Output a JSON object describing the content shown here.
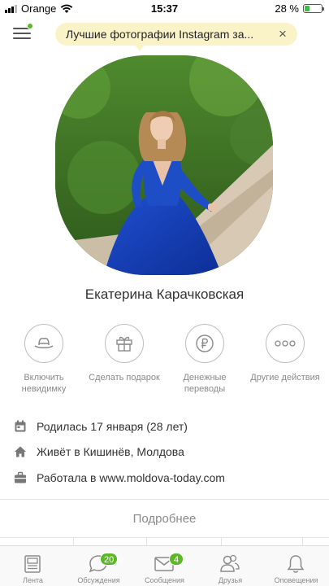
{
  "status_bar": {
    "carrier": "Orange",
    "time": "15:37",
    "battery_percent": "28 %",
    "battery_level": 0.28
  },
  "banner": {
    "text": "Лучшие фотографии Instagram за...",
    "close_glyph": "×"
  },
  "profile": {
    "name": "Екатерина Карачковская"
  },
  "actions": [
    {
      "label_line1": "Включить",
      "label_line2": "невидимку",
      "icon": "hat-icon"
    },
    {
      "label_line1": "Сделать подарок",
      "label_line2": "",
      "icon": "gift-icon"
    },
    {
      "label_line1": "Денежные",
      "label_line2": "переводы",
      "icon": "ruble-icon"
    },
    {
      "label_line1": "Другие действия",
      "label_line2": "",
      "icon": "more-dots-icon"
    }
  ],
  "info": {
    "birth": "Родилась 17 января (28 лет)",
    "lives_prefix": "Живёт в",
    "lives_place": "Кишинёв, Молдова",
    "work_prefix": "Работала в",
    "work_place": "www.moldova-today.com"
  },
  "more_button": "Подробнее",
  "tabbar": [
    {
      "label": "Лента",
      "badge": "",
      "icon": "feed-icon"
    },
    {
      "label": "Обсуждения",
      "badge": "20",
      "icon": "discussions-icon"
    },
    {
      "label": "Сообщения",
      "badge": "4",
      "icon": "messages-icon"
    },
    {
      "label": "Друзья",
      "badge": "",
      "icon": "friends-icon"
    },
    {
      "label": "Оповещения",
      "badge": "",
      "icon": "bell-icon"
    }
  ],
  "colors": {
    "accent_green": "#5cb827",
    "banner_bg": "#fbf3c8",
    "muted_text": "#8a8a8a"
  }
}
